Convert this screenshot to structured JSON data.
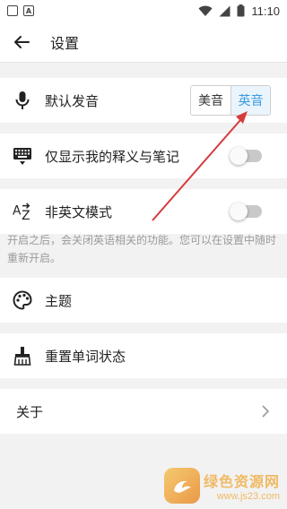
{
  "status_bar": {
    "time": "11:10",
    "left_icons": [
      "notification-icon",
      "image-icon"
    ],
    "right_icons": [
      "wifi-icon",
      "signal-icon",
      "battery-icon"
    ]
  },
  "header": {
    "title": "设置"
  },
  "settings": {
    "pronunciation": {
      "label": "默认发音",
      "options": [
        "美音",
        "英音"
      ],
      "selected": "英音"
    },
    "only_mine": {
      "label": "仅显示我的释义与笔记",
      "enabled": false
    },
    "non_english": {
      "label": "非英文模式",
      "enabled": false,
      "hint": "开启之后，会关闭英语相关的功能。您可以在设置中随时重新开启。"
    },
    "theme": {
      "label": "主题"
    },
    "reset_words": {
      "label": "重置单词状态"
    },
    "about": {
      "label": "关于"
    }
  },
  "watermark": {
    "name": "绿色资源网",
    "url": "www.js23.com"
  },
  "colors": {
    "accent": "#3a9ae0",
    "annotation_arrow": "#d63b3b",
    "toggle_off": "#c9c9c9"
  }
}
